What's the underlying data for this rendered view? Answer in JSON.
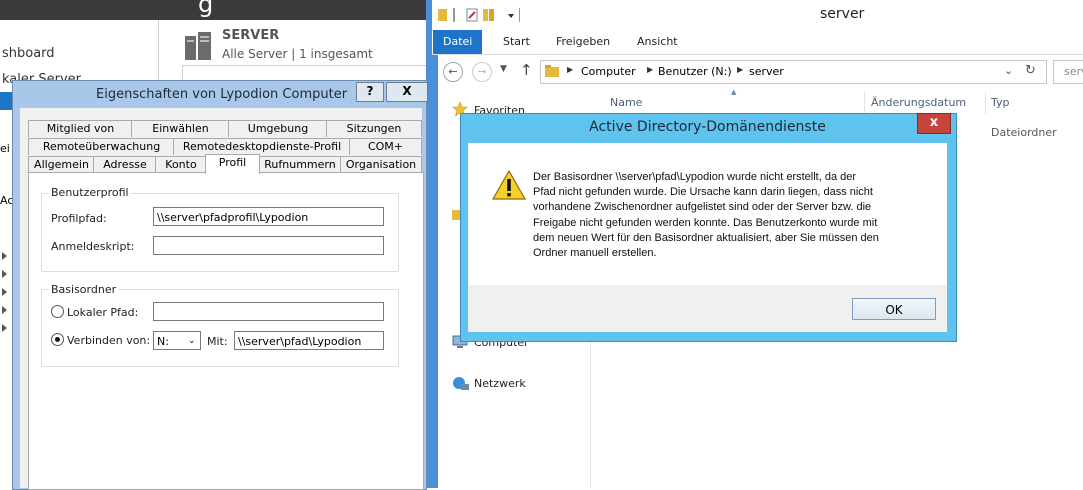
{
  "server_manager": {
    "title_fragment": "g",
    "nav_dashboard": "shboard",
    "nav_lokaler": "kaler Server",
    "server_title": "SERVER",
    "server_subtitle": "Alle Server | 1 insgesamt",
    "tree_fragments": [
      "ei",
      "Ac"
    ]
  },
  "explorer": {
    "title": "server",
    "ribbon_tabs": [
      "Datei",
      "Start",
      "Freigeben",
      "Ansicht"
    ],
    "address_parts": [
      "Computer",
      "Benutzer (N:)",
      "server"
    ],
    "search_fragment": "serv",
    "columns": [
      "Name",
      "Änderungsdatum",
      "Typ"
    ],
    "row_type": "Dateiordner",
    "nav_favoriten": "Favoriten",
    "nav_computer": "Computer",
    "nav_netzwerk": "Netzwerk"
  },
  "properties": {
    "title": "Eigenschaften von Lypodion Computer",
    "help_btn": "?",
    "close_btn": "X",
    "tabs_row1": [
      "Mitglied von",
      "Einwählen",
      "Umgebung",
      "Sitzungen"
    ],
    "tabs_row2": [
      "Remoteüberwachung",
      "Remotedesktopdienste-Profil",
      "COM+"
    ],
    "tabs_row3": [
      "Allgemein",
      "Adresse",
      "Konto",
      "Profil",
      "Rufnummern",
      "Organisation"
    ],
    "group_profile": "Benutzerprofil",
    "profile_path_label": "Profilpfad:",
    "profile_path_value": "\\\\server\\pfadprofil\\Lypodion",
    "logon_script_label": "Anmeldeskript:",
    "logon_script_value": "",
    "group_home": "Basisordner",
    "local_path_label": "Lokaler Pfad:",
    "local_path_value": "",
    "connect_label": "Verbinden von:",
    "drive_value": "N:",
    "with_label": "Mit:",
    "connect_value": "\\\\server\\pfad\\Lypodion"
  },
  "message_box": {
    "title": "Active Directory-Domänendienste",
    "close": "x",
    "lines": [
      "Der Basisordner \\\\server\\pfad\\Lypodion wurde nicht erstellt, da der",
      "Pfad nicht gefunden wurde. Die Ursache kann darin liegen, dass nicht",
      "vorhandene Zwischenordner aufgelistet sind oder der Server bzw. die",
      "Freigabe nicht gefunden werden konnte. Das Benutzerkonto wurde mit",
      "dem neuen Wert für den Basisordner aktualisiert, aber Sie müssen den",
      "Ordner manuell erstellen."
    ],
    "ok_label": "OK"
  },
  "colors": {
    "accent": "#1e74c8",
    "dialog_frame": "#a9c7e8",
    "msgbox_frame": "#5fc3ee",
    "close_red": "#c7443d"
  },
  "icons": [
    "server-icon",
    "folder-icon",
    "star-icon",
    "computer-icon",
    "network-icon",
    "warning-icon",
    "back-arrow-icon",
    "forward-arrow-icon",
    "up-arrow-icon",
    "refresh-icon",
    "chevron-down-icon"
  ]
}
